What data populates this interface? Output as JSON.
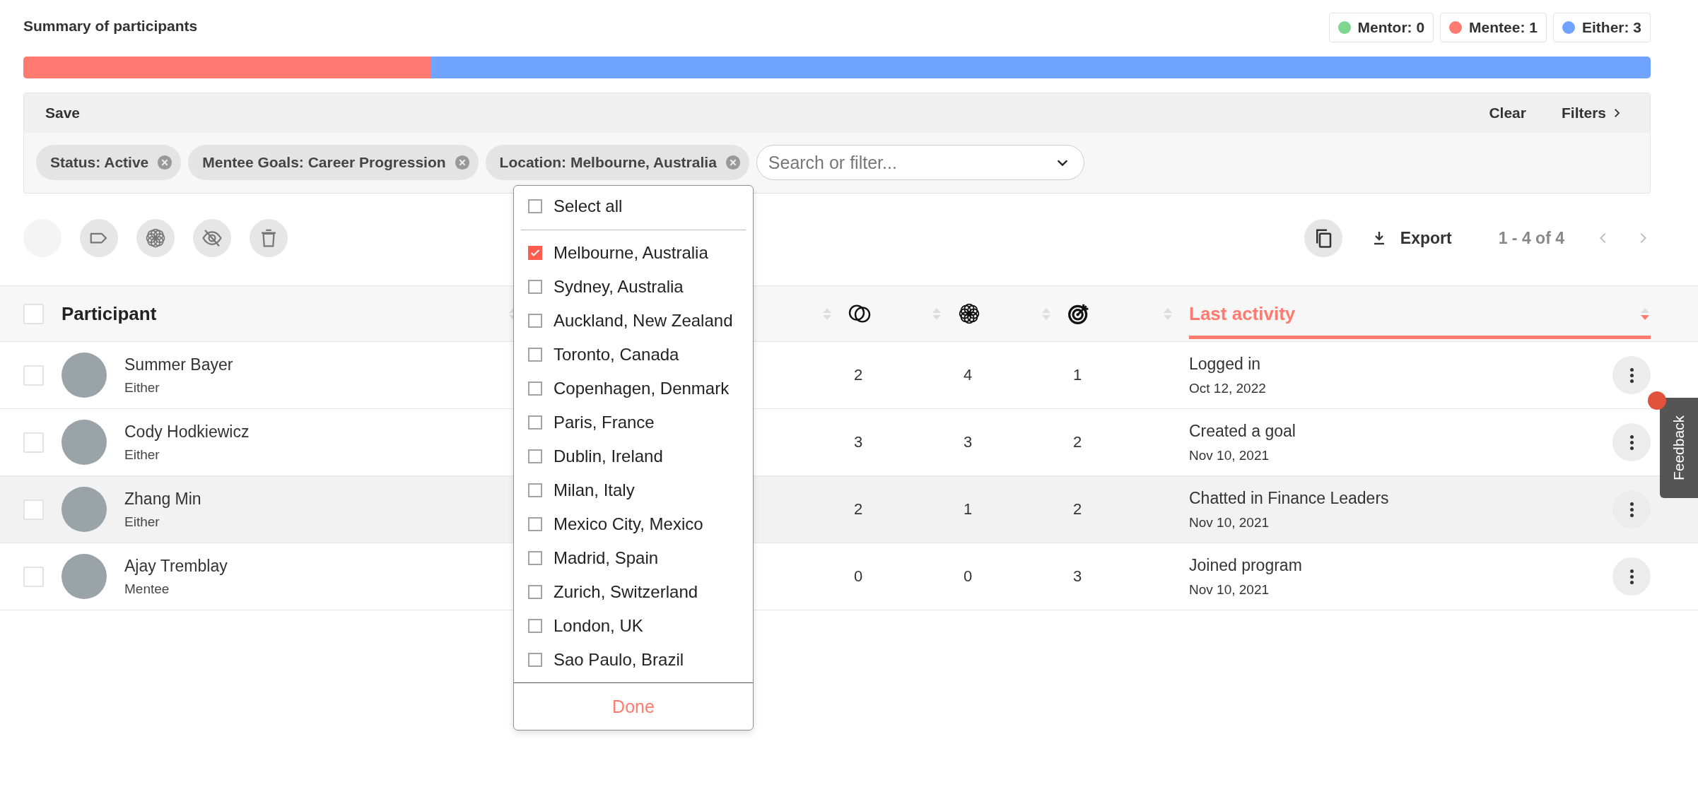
{
  "summary": {
    "title": "Summary of participants",
    "legend": [
      {
        "label": "Mentor: 0",
        "color": "#7fd68f"
      },
      {
        "label": "Mentee: 1",
        "color": "#ff7b72",
        "level": 0.25
      },
      {
        "label": "Either: 3",
        "color": "#70a2ff",
        "level": 0.75
      }
    ]
  },
  "filters": {
    "save": "Save",
    "clear": "Clear",
    "filters": "Filters",
    "chips": [
      {
        "label": "Status: Active"
      },
      {
        "label": "Mentee Goals: Career Progression"
      },
      {
        "label": "Location: Melbourne, Australia"
      }
    ],
    "search": {
      "placeholder": "Search or filter..."
    }
  },
  "toolbar": {
    "export": "Export",
    "range": "1 - 4 of 4"
  },
  "table": {
    "all_checked": false,
    "columns": [
      {
        "kind": "text",
        "label": "Participant",
        "selected": false
      },
      {
        "kind": "blank",
        "selected": false
      },
      {
        "kind": "icon",
        "selected": false
      },
      {
        "kind": "icon",
        "selected": false
      },
      {
        "kind": "icon",
        "selected": false
      },
      {
        "kind": "text",
        "label": "Last activity",
        "selected": true
      }
    ],
    "rows": [
      {
        "name": "Summer Bayer",
        "role": "Either",
        "stats": [
          "2",
          "4",
          "1"
        ],
        "activity": "Logged in",
        "date": "Oct 12, 2022",
        "checked": false,
        "hovered": false
      },
      {
        "name": "Cody Hodkiewicz",
        "role": "Either",
        "stats": [
          "3",
          "3",
          "2"
        ],
        "activity": "Created a goal",
        "date": "Nov 10, 2021",
        "checked": false,
        "hovered": false
      },
      {
        "name": "Zhang Min",
        "role": "Either",
        "stats": [
          "2",
          "1",
          "2"
        ],
        "activity": "Chatted in Finance Leaders",
        "date": "Nov 10, 2021",
        "checked": false,
        "hovered": true
      },
      {
        "name": "Ajay Tremblay",
        "role": "Mentee",
        "stats": [
          "0",
          "0",
          "3"
        ],
        "activity": "Joined program",
        "date": "Nov 10, 2021",
        "checked": false,
        "hovered": false
      }
    ]
  },
  "dropdown": {
    "select_all": {
      "label": "Select all",
      "checked": false
    },
    "options": [
      {
        "label": "Melbourne, Australia",
        "checked": true
      },
      {
        "label": "Sydney, Australia",
        "checked": false
      },
      {
        "label": "Auckland, New Zealand",
        "checked": false
      },
      {
        "label": "Toronto, Canada",
        "checked": false
      },
      {
        "label": "Copenhagen, Denmark",
        "checked": false
      },
      {
        "label": "Paris, France",
        "checked": false
      },
      {
        "label": "Dublin, Ireland",
        "checked": false
      },
      {
        "label": "Milan, Italy",
        "checked": false
      },
      {
        "label": "Mexico City, Mexico",
        "checked": false
      },
      {
        "label": "Madrid, Spain",
        "checked": false
      },
      {
        "label": "Zurich, Switzerland",
        "checked": false
      },
      {
        "label": "London, UK",
        "checked": false
      },
      {
        "label": "Sao Paulo, Brazil",
        "checked": false
      }
    ],
    "done": "Done"
  },
  "feedback": {
    "label": "Feedback",
    "notification": true
  }
}
